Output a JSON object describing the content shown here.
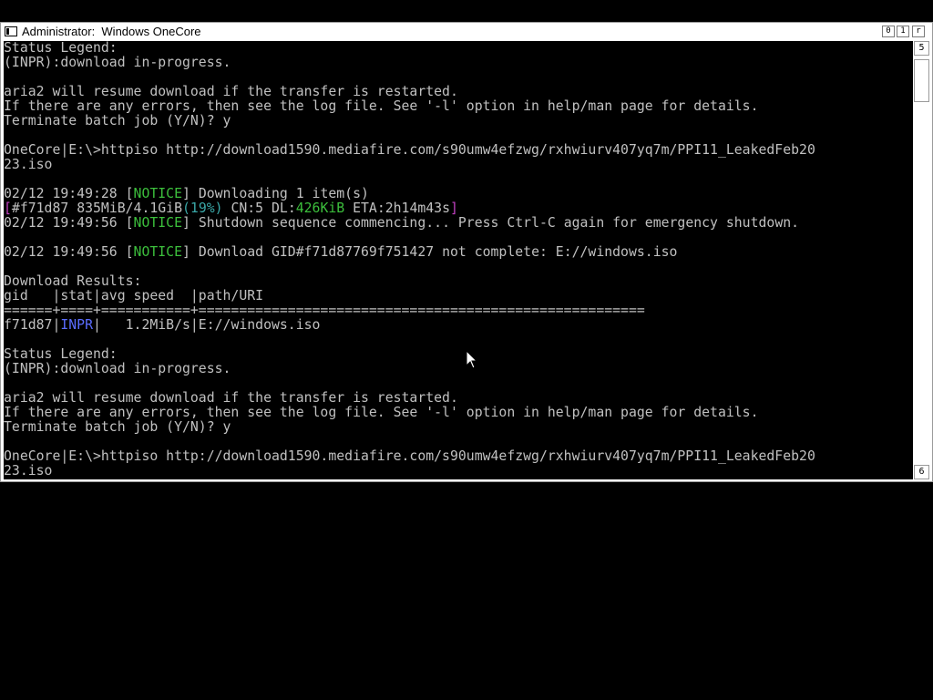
{
  "window": {
    "title": "Administrator:  Windows OneCore",
    "buttons": {
      "minimize": "0",
      "maximize": "1",
      "close": "r"
    }
  },
  "scrollbar": {
    "up_glyph": "5",
    "down_glyph": "6"
  },
  "console": {
    "lines": [
      [
        {
          "t": "Status Legend:"
        }
      ],
      [
        {
          "t": "(INPR):download in-progress."
        }
      ],
      [
        {
          "t": ""
        }
      ],
      [
        {
          "t": "aria2 will resume download if the transfer is restarted."
        }
      ],
      [
        {
          "t": "If there are any errors, then see the log file. See '-l' option in help/man page for details."
        }
      ],
      [
        {
          "t": "Terminate batch job (Y/N)? y"
        }
      ],
      [
        {
          "t": ""
        }
      ],
      [
        {
          "t": "OneCore|E:\\>httpiso http://download1590.mediafire.com/s90umw4efzwg/rxhwiurv407yq7m/PPI11_LeakedFeb20"
        }
      ],
      [
        {
          "t": "23.iso"
        }
      ],
      [
        {
          "t": ""
        }
      ],
      [
        {
          "t": "02/12 19:49:28 ["
        },
        {
          "t": "NOTICE",
          "c": "green"
        },
        {
          "t": "] Downloading 1 item(s)"
        }
      ],
      [
        {
          "t": "[",
          "c": "magenta"
        },
        {
          "t": "#f71d87 835MiB/4.1GiB"
        },
        {
          "t": "(19%)",
          "c": "cyan"
        },
        {
          "t": " CN:5 DL:"
        },
        {
          "t": "426KiB",
          "c": "green"
        },
        {
          "t": " ETA:2h14m43s"
        },
        {
          "t": "]",
          "c": "magenta"
        }
      ],
      [
        {
          "t": "02/12 19:49:56 ["
        },
        {
          "t": "NOTICE",
          "c": "green"
        },
        {
          "t": "] Shutdown sequence commencing... Press Ctrl-C again for emergency shutdown."
        }
      ],
      [
        {
          "t": ""
        }
      ],
      [
        {
          "t": "02/12 19:49:56 ["
        },
        {
          "t": "NOTICE",
          "c": "green"
        },
        {
          "t": "] Download GID#f71d87769f751427 not complete: E://windows.iso"
        }
      ],
      [
        {
          "t": ""
        }
      ],
      [
        {
          "t": "Download Results:"
        }
      ],
      [
        {
          "t": "gid   |stat|avg speed  |path/URI"
        }
      ],
      [
        {
          "t": "======+====+===========+======================================================="
        }
      ],
      [
        {
          "t": "f71d87|"
        },
        {
          "t": "INPR",
          "c": "blue"
        },
        {
          "t": "|   1.2MiB/s|E://windows.iso"
        }
      ],
      [
        {
          "t": ""
        }
      ],
      [
        {
          "t": "Status Legend:"
        }
      ],
      [
        {
          "t": "(INPR):download in-progress."
        }
      ],
      [
        {
          "t": ""
        }
      ],
      [
        {
          "t": "aria2 will resume download if the transfer is restarted."
        }
      ],
      [
        {
          "t": "If there are any errors, then see the log file. See '-l' option in help/man page for details."
        }
      ],
      [
        {
          "t": "Terminate batch job (Y/N)? y"
        }
      ],
      [
        {
          "t": ""
        }
      ],
      [
        {
          "t": "OneCore|E:\\>httpiso http://download1590.mediafire.com/s90umw4efzwg/rxhwiurv407yq7m/PPI11_LeakedFeb20"
        }
      ],
      [
        {
          "t": "23.iso"
        }
      ]
    ]
  }
}
